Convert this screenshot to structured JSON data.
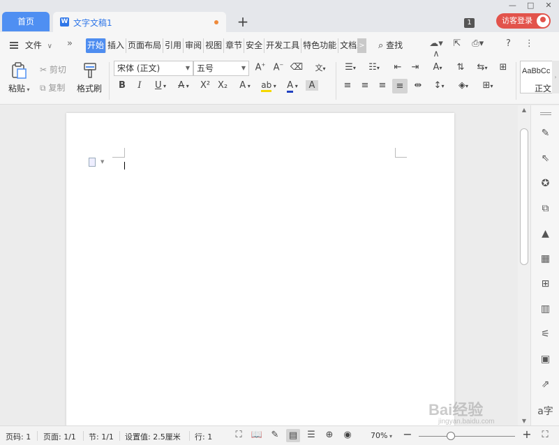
{
  "tabs": {
    "home": "首页",
    "document": "文字文稿1",
    "document_icon": "W",
    "add": "+",
    "window_count": "1",
    "login": "访客登录"
  },
  "window_controls": [
    "—",
    "□",
    "✕"
  ],
  "menu": {
    "file": "文件",
    "file_arrow": "∨",
    "more": "»",
    "items": [
      {
        "label": "开始",
        "active": true
      },
      {
        "label": "插入"
      },
      {
        "label": "页面布局"
      },
      {
        "label": "引用"
      },
      {
        "label": "审阅"
      },
      {
        "label": "视图"
      },
      {
        "label": "章节"
      },
      {
        "label": "安全"
      },
      {
        "label": "开发工具"
      },
      {
        "label": "特色功能"
      },
      {
        "label": "文档助"
      }
    ],
    "scroll_arrow": ">",
    "find": "查找",
    "right_icons": [
      "☁▾",
      "⇱",
      "⎙▾",
      "?",
      "⋮",
      "∧"
    ]
  },
  "ribbon": {
    "paste": "粘贴",
    "cut": "剪切",
    "copy": "复制",
    "format_painter": "格式刷",
    "font_name": "宋体 (正文)",
    "font_size": "五号",
    "style_preview": "AaBbCc",
    "style_name": "正文",
    "format_buttons": [
      "B",
      "I",
      "U",
      "A",
      "X²",
      "X₂",
      "A",
      "ab",
      "A",
      "A"
    ]
  },
  "status": {
    "page_num": "页码: 1",
    "pages": "页面: 1/1",
    "section": "节: 1/1",
    "setting": "设置值: 2.5厘米",
    "line": "行: 1",
    "zoom": "70%",
    "zoom_level_percent": 70
  },
  "watermark": {
    "brand": "Bai经验",
    "url": "jingyan.baidu.com"
  },
  "colors": {
    "accent": "#4f8ff2",
    "login_bg": "#e2534b",
    "modified_dot": "#ee8a3b",
    "highlight_yellow": "#f5d800",
    "font_color_red": "#e03030"
  }
}
